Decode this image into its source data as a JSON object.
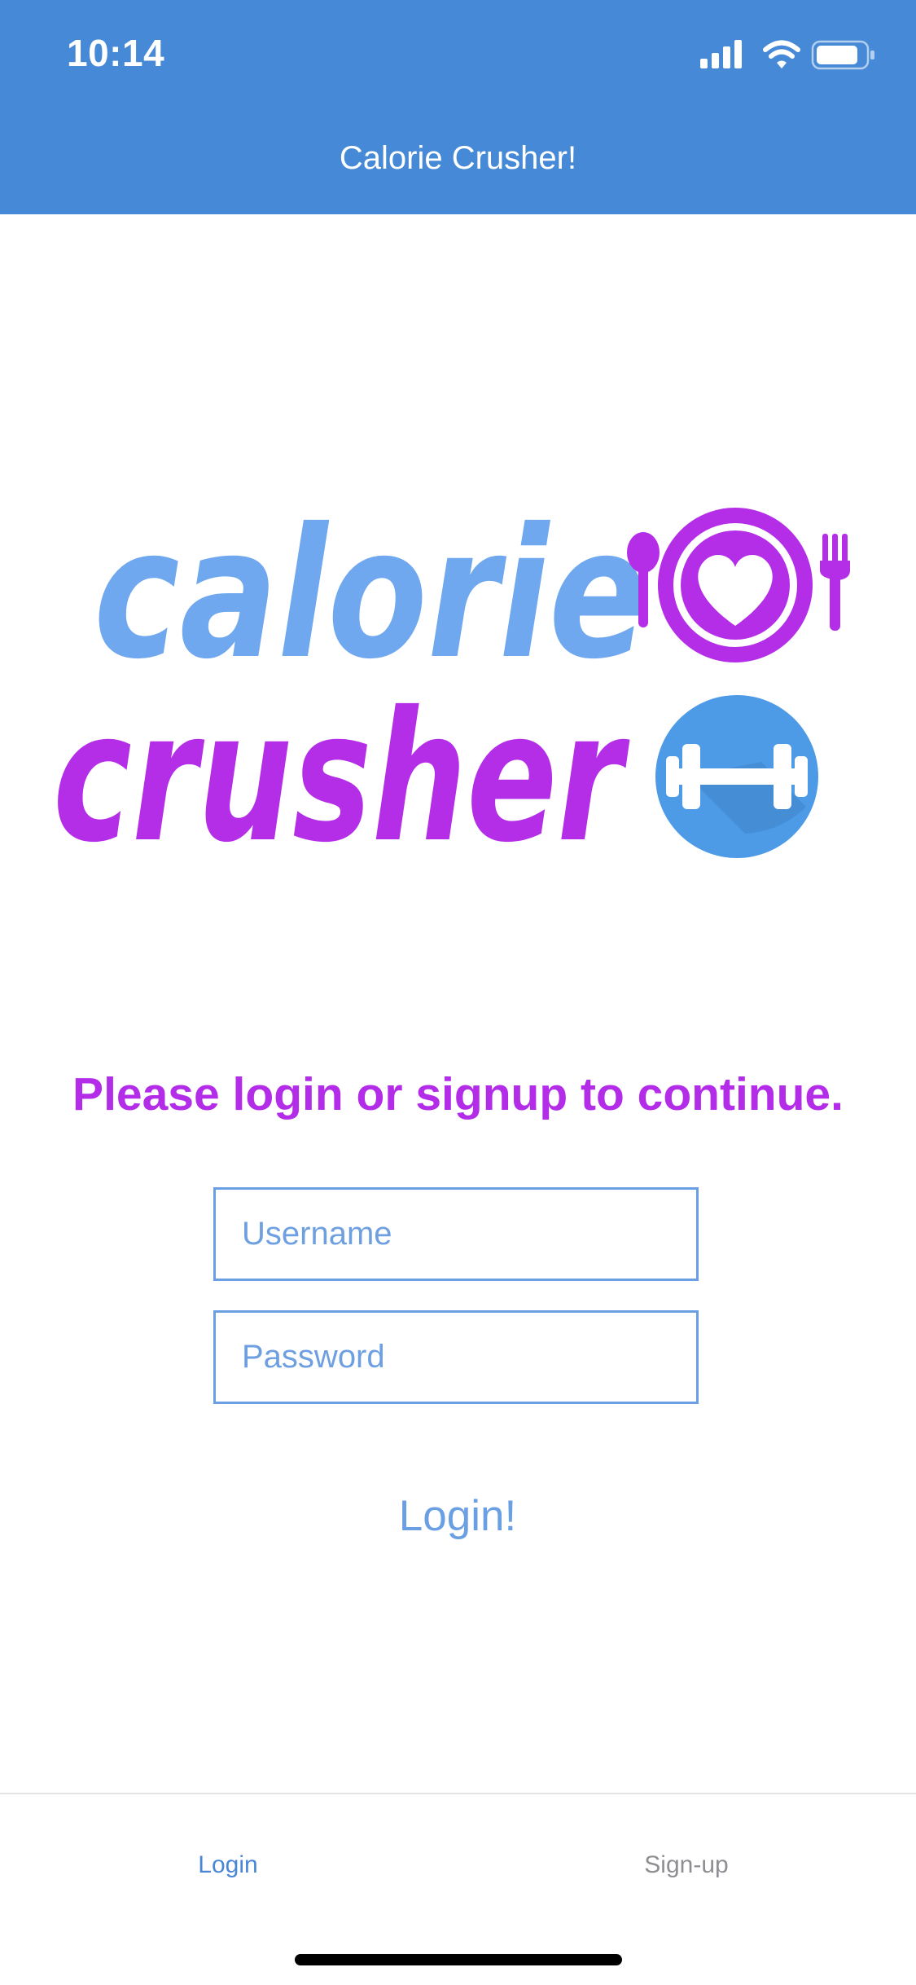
{
  "status_bar": {
    "time": "10:14"
  },
  "header": {
    "title": "Calorie Crusher!"
  },
  "logo": {
    "line1": "calorie",
    "line2": "crusher",
    "colors": {
      "line1": "#6fa8ef",
      "line2": "#b42ee8",
      "plate_icon": "#b42ee8",
      "dumbbell_circle": "#4d9be6"
    }
  },
  "prompt": "Please login or signup to continue.",
  "form": {
    "username": {
      "value": "",
      "placeholder": "Username"
    },
    "password": {
      "value": "",
      "placeholder": "Password"
    },
    "login_label": "Login!"
  },
  "tabs": [
    {
      "label": "Login",
      "active": true
    },
    {
      "label": "Sign-up",
      "active": false
    }
  ],
  "colors": {
    "header": "#4689d6",
    "accent": "#6a9fe4",
    "prompt": "#b32de9",
    "tab_active": "#4a86d6",
    "tab_inactive": "#8e8e93"
  }
}
